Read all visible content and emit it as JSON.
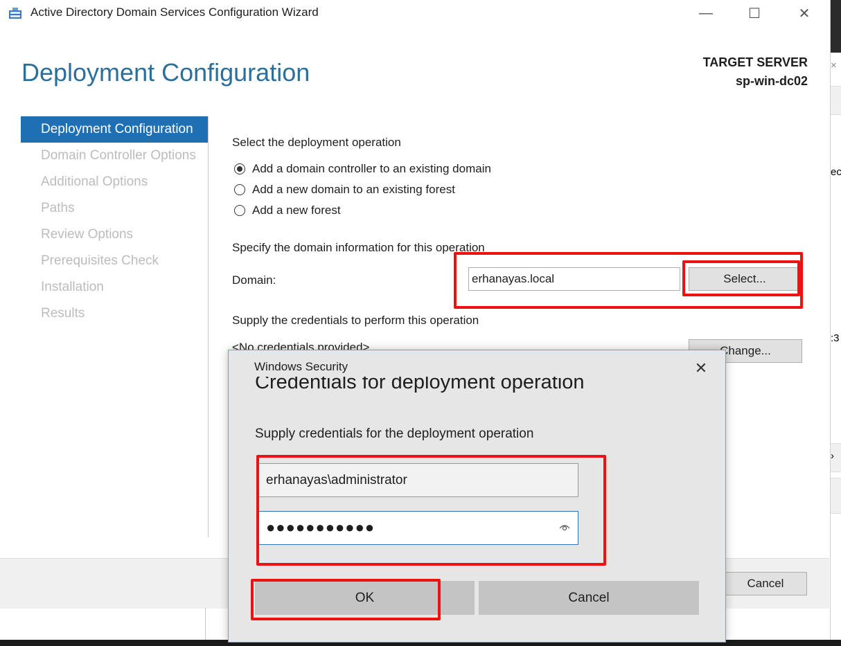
{
  "window": {
    "title": "Active Directory Domain Services Configuration Wizard",
    "minimize_glyph": "—",
    "maximize_glyph": "☐",
    "close_glyph": "✕"
  },
  "background_app": {
    "fragments": [
      "ec",
      ":3",
      "›"
    ]
  },
  "header": {
    "page_title": "Deployment Configuration",
    "target_label": "TARGET SERVER",
    "target_name": "sp-win-dc02"
  },
  "nav": {
    "items": [
      {
        "label": "Deployment Configuration",
        "active": true
      },
      {
        "label": "Domain Controller Options",
        "active": false
      },
      {
        "label": "Additional Options",
        "active": false
      },
      {
        "label": "Paths",
        "active": false
      },
      {
        "label": "Review Options",
        "active": false
      },
      {
        "label": "Prerequisites Check",
        "active": false
      },
      {
        "label": "Installation",
        "active": false
      },
      {
        "label": "Results",
        "active": false
      }
    ]
  },
  "main": {
    "operation_heading": "Select the deployment operation",
    "options": [
      {
        "label": "Add a domain controller to an existing domain",
        "selected": true
      },
      {
        "label": "Add a new domain to an existing forest",
        "selected": false
      },
      {
        "label": "Add a new forest",
        "selected": false
      }
    ],
    "domain_heading": "Specify the domain information for this operation",
    "domain_label": "Domain:",
    "domain_value": "erhanayas.local",
    "select_button": "Select...",
    "credentials_heading": "Supply the credentials to perform this operation",
    "credentials_value": "<No credentials provided>",
    "change_button": "Change..."
  },
  "footer": {
    "cancel_button": "Cancel"
  },
  "dialog": {
    "title": "Windows Security",
    "close_glyph": "✕",
    "heading": "Credentials for deployment operation",
    "subheading": "Supply credentials for the deployment operation",
    "username_value": "erhanayas\\administrator",
    "password_value": "●●●●●●●●●●●",
    "ok_button": "OK",
    "cancel_button": "Cancel"
  },
  "colors": {
    "accent": "#1f6fb5",
    "title_blue": "#2d6f9b",
    "highlight_red": "#ee1111"
  }
}
